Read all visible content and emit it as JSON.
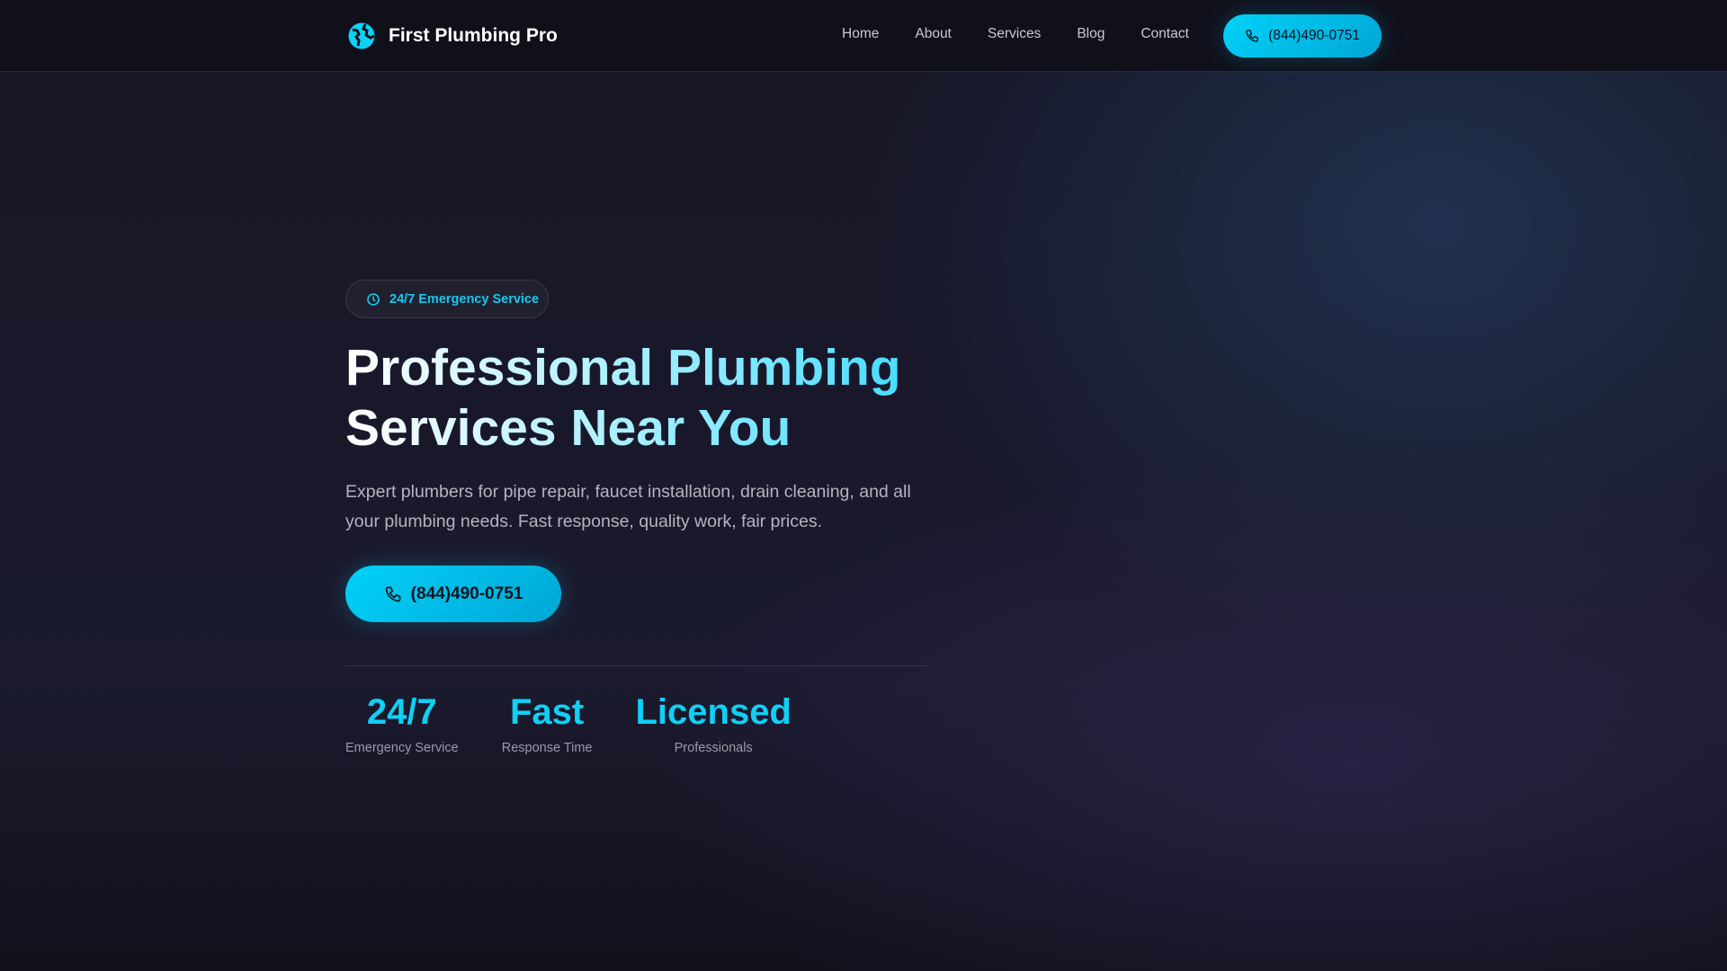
{
  "header": {
    "brand": "First Plumbing Pro",
    "nav": [
      "Home",
      "About",
      "Services",
      "Blog",
      "Contact"
    ],
    "phone": "(844)490-0751"
  },
  "hero": {
    "badge": "24/7 Emergency Service",
    "title_line1": "Professional Plumbing",
    "title_line2": "Services Near You",
    "description": "Expert plumbers for pipe repair, faucet installation, drain cleaning, and all your plumbing needs. Fast response, quality work, fair prices.",
    "cta_phone": "(844)490-0751"
  },
  "stats": [
    {
      "value": "24/7",
      "label": "Emergency Service"
    },
    {
      "value": "Fast",
      "label": "Response Time"
    },
    {
      "value": "Licensed",
      "label": "Professionals"
    }
  ],
  "colors": {
    "accent": "#00c8f0",
    "background": "#1b1a2e"
  }
}
